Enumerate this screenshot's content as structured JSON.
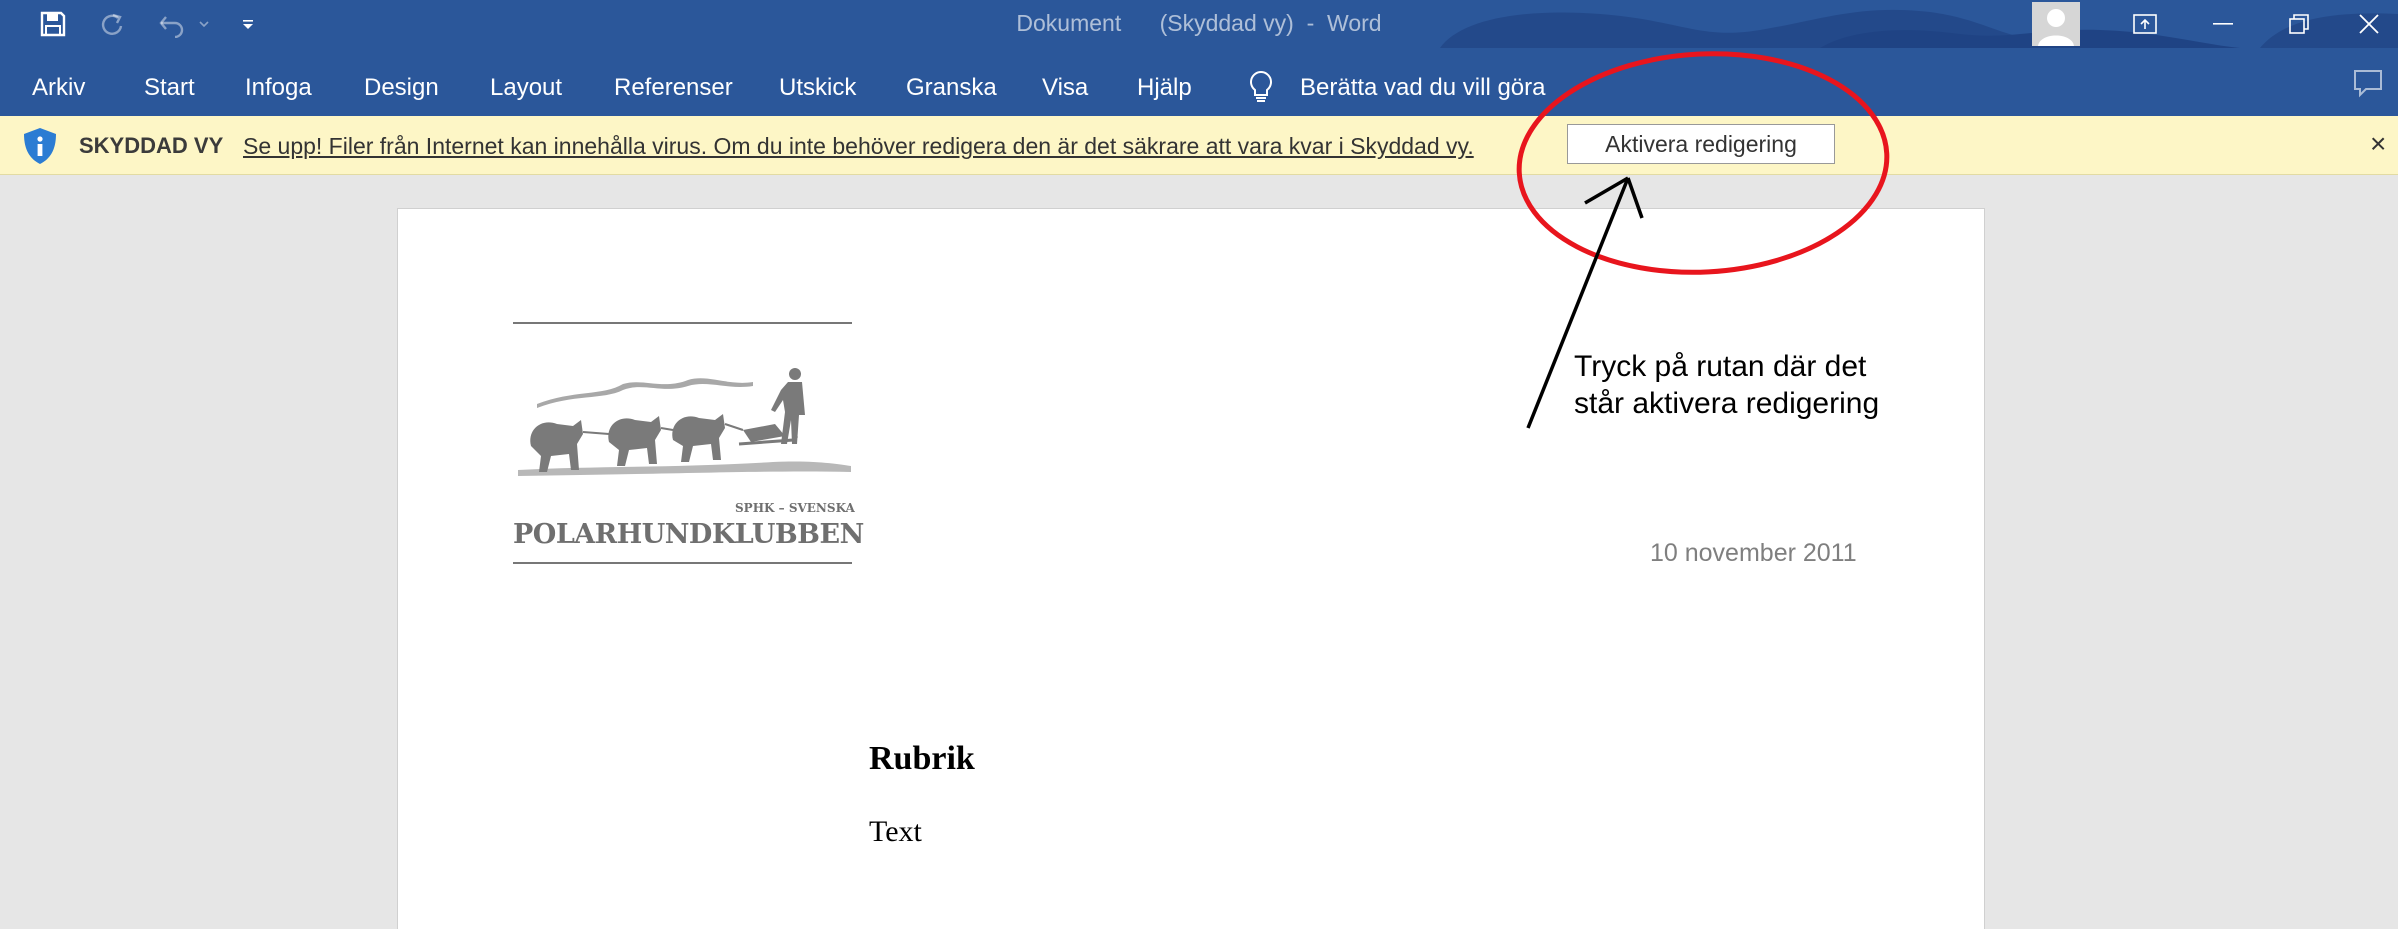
{
  "window": {
    "title_doc": "Dokument",
    "title_mode": "(Skyddad vy)",
    "title_sep": "-",
    "title_app": "Word"
  },
  "quick_access": [
    {
      "name": "save-icon"
    },
    {
      "name": "redo-icon"
    },
    {
      "name": "undo-icon"
    },
    {
      "name": "customize-quick-access-icon"
    }
  ],
  "window_controls": [
    "account-avatar",
    "ribbon-display-options-icon",
    "minimize-icon",
    "restore-icon",
    "close-icon"
  ],
  "menu": {
    "items": [
      "Arkiv",
      "Start",
      "Infoga",
      "Design",
      "Layout",
      "Referenser",
      "Utskick",
      "Granska",
      "Visa",
      "Hjälp"
    ],
    "tell_me": "Berätta vad du vill göra"
  },
  "protected_bar": {
    "label": "SKYDDAD VY",
    "message": "Se upp! Filer från Internet kan innehålla virus. Om du inte behöver redigera den är det säkrare att vara kvar i Skyddad vy.",
    "button": "Aktivera redigering",
    "close": "×"
  },
  "document": {
    "logo_small": "SPHK – SVENSKA",
    "logo_name": "POLARHUNDKLUBBEN",
    "date": "10 november 2011",
    "heading": "Rubrik",
    "body": "Text"
  },
  "annotation": {
    "line1": "Tryck på rutan där det",
    "line2": "står aktivera redigering"
  },
  "colors": {
    "ribbon": "#2b579a",
    "protected_bar": "#fdf6c6",
    "annotation_circle": "#e8151d"
  }
}
